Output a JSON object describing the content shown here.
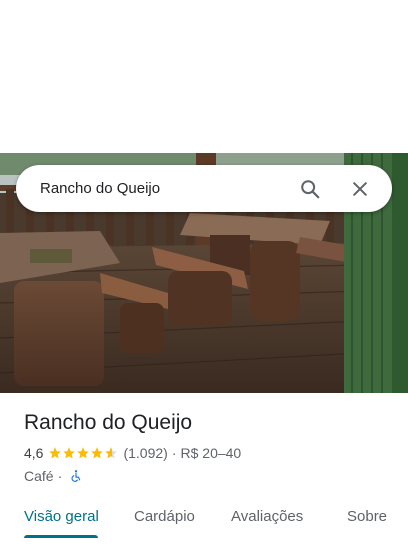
{
  "search": {
    "query": "Rancho do Queijo",
    "search_icon": "search-icon",
    "close_icon": "close-icon"
  },
  "photo": {
    "subject": "place-photo"
  },
  "place": {
    "title": "Rancho do Queijo",
    "rating": "4,6",
    "stars": 4.6,
    "reviews": "(1.092)",
    "separator": "·",
    "price": "R$ 20–40",
    "category": "Café",
    "category_separator": "·",
    "accessibility_icon": "wheelchair-icon"
  },
  "tabs": [
    {
      "label": "Visão geral",
      "active": true
    },
    {
      "label": "Cardápio",
      "active": false
    },
    {
      "label": "Avaliações",
      "active": false
    },
    {
      "label": "Sobre",
      "active": false
    }
  ],
  "colors": {
    "accent": "#00718a",
    "star": "#fbbc04",
    "accessibility": "#1a73e8"
  }
}
